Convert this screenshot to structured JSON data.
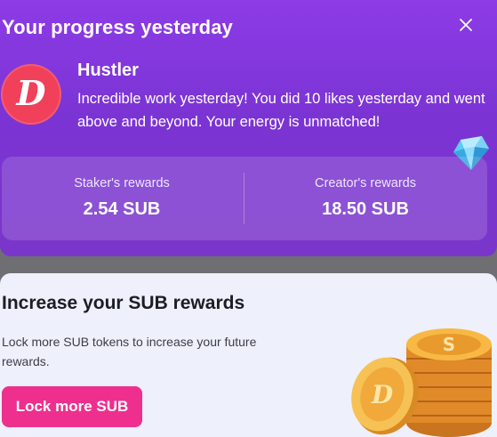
{
  "header": {
    "title": "Your progress yesterday",
    "close_icon": "close-icon"
  },
  "profile": {
    "logo_letter": "D",
    "logo_color": "#f0405a",
    "name": "Hustler",
    "message": "Incredible work yesterday! You did 10 likes yesterday and went above and beyond. Your energy is unmatched!"
  },
  "rewards": {
    "staker": {
      "label": "Staker's rewards",
      "value": "2.54 SUB"
    },
    "creator": {
      "label": "Creator's rewards",
      "value": "18.50 SUB"
    }
  },
  "promo": {
    "title": "Increase your SUB rewards",
    "description": "Lock more SUB tokens to increase your future rewards.",
    "button_label": "Lock more SUB",
    "button_color": "#ee2f8e"
  },
  "colors": {
    "card_purple": "#8d3be6",
    "promo_bg": "#eef0fb",
    "coin_gold": "#f4a93a"
  }
}
